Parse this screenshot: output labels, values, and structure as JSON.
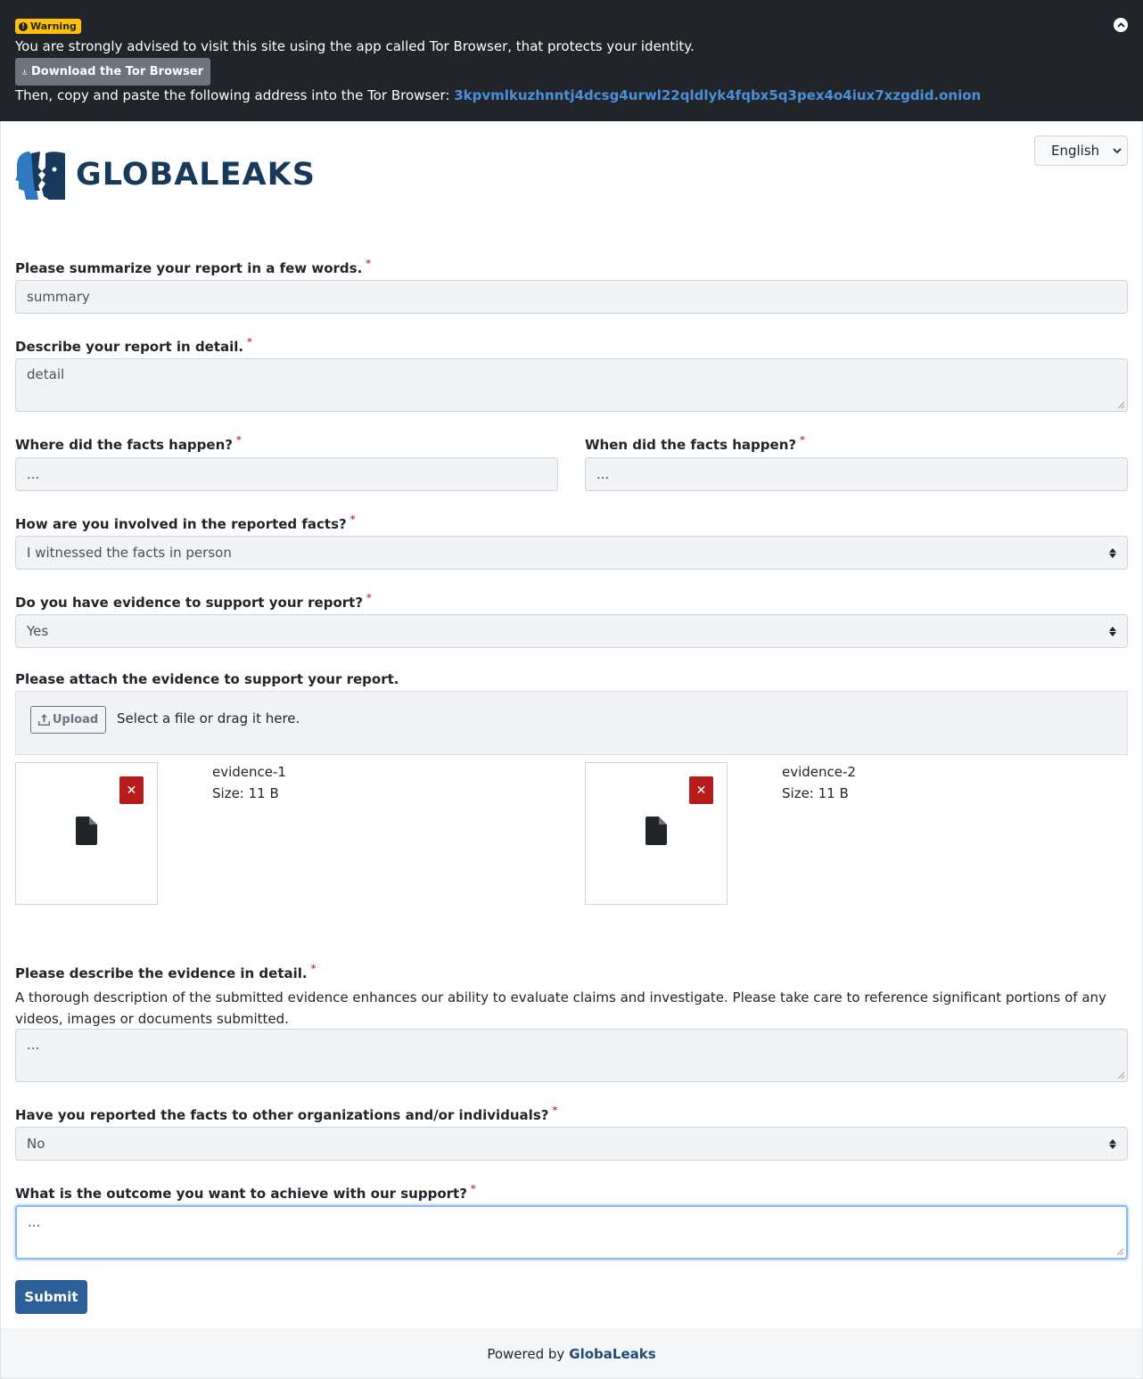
{
  "banner": {
    "badge_label": "Warning",
    "message": "You are strongly advised to visit this site using the app called Tor Browser, that protects your identity.",
    "download_label": "Download the Tor Browser",
    "copy_text": "Then, copy and paste the following address into the Tor Browser:",
    "onion_address": "3kpvmlkuzhnntj4dcsg4urwl22qldlyk4fqbx5q3pex4o4iux7xzgdid.onion"
  },
  "header": {
    "logo_text": "GLOBALEAKS",
    "language": "English"
  },
  "form": {
    "summary": {
      "label": "Please summarize your report in a few words.",
      "required_mark": "*",
      "value": "summary"
    },
    "detail": {
      "label": "Describe your report in detail.",
      "required_mark": "*",
      "value": "detail"
    },
    "where": {
      "label": "Where did the facts happen?",
      "required_mark": "*",
      "placeholder": "..."
    },
    "when": {
      "label": "When did the facts happen?",
      "required_mark": "*",
      "placeholder": "..."
    },
    "involvement": {
      "label": "How are you involved in the reported facts?",
      "required_mark": "*",
      "value": "I witnessed the facts in person"
    },
    "evidence": {
      "label": "Do you have evidence to support your report?",
      "required_mark": "*",
      "value": "Yes"
    },
    "attach": {
      "label": "Please attach the evidence to support your report.",
      "upload_label": "Upload",
      "drop_text": "Select a file or drag it here.",
      "files": [
        {
          "name": "evidence-1",
          "size": "Size: 11 B"
        },
        {
          "name": "evidence-2",
          "size": "Size: 11 B"
        }
      ]
    },
    "evidence_desc": {
      "label": "Please describe the evidence in detail.",
      "required_mark": "*",
      "help": "A thorough description of the submitted evidence enhances our ability to evaluate claims and investigate. Please take care to reference significant portions of any videos, images or documents submitted.",
      "placeholder": "..."
    },
    "reported_other": {
      "label": "Have you reported the facts to other organizations and/or individuals?",
      "required_mark": "*",
      "value": "No"
    },
    "outcome": {
      "label": "What is the outcome you want to achieve with our support?",
      "required_mark": "*",
      "placeholder": "..."
    },
    "submit_label": "Submit"
  },
  "footer": {
    "powered_by": "Powered by",
    "brand": "GlobaLeaks"
  },
  "colors": {
    "banner_bg": "#212529",
    "warning_badge": "#ffc107",
    "onion_link": "#4a90d9",
    "brand_navy": "#183a5a",
    "submit_bg": "#2c5f97",
    "delete_red": "#b71c1c",
    "required_red": "#dc3545"
  },
  "icons": {
    "warning": "exclamation-circle-icon",
    "download": "download-icon",
    "collapse": "chevron-up-circle-icon",
    "upload": "upload-icon",
    "delete": "close-icon",
    "file": "file-icon"
  }
}
